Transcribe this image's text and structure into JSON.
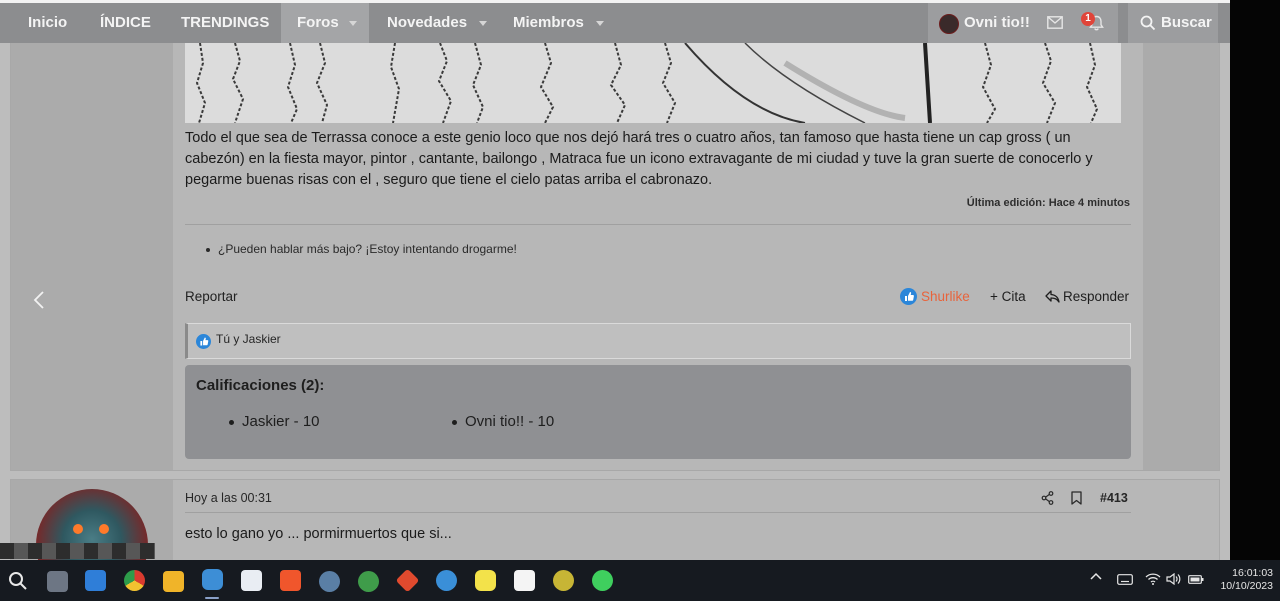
{
  "nav": {
    "items": [
      "Inicio",
      "ÍNDICE",
      "TRENDINGS",
      "Foros",
      "Novedades",
      "Miembros"
    ],
    "active": "Foros",
    "user_name": "Ovni tio!!",
    "notification_count": "1",
    "search_label": "Buscar"
  },
  "post": {
    "body": "Todo el que sea de Terrassa conoce a este genio loco que nos dejó hará tres o cuatro años, tan famoso que hasta tiene un cap gross ( un cabezón) en la fiesta mayor, pintor , cantante, bailongo , Matraca fue un icono extravagante de mi ciudad y tuve la gran suerte de conocerlo y pegarme buenas risas con el , seguro que tiene el cielo patas arriba el cabronazo.",
    "edit_note": "Última edición: Hace 4 minutos",
    "signature": "¿Pueden hablar más bajo? ¡Estoy intentando drogarme!",
    "report_label": "Reportar",
    "like_label": "Shurlike",
    "quote_label": "+ Cita",
    "reply_label": "Responder",
    "reactions_text": "Tú y Jaskier",
    "ratings_title": "Calificaciones (2):",
    "ratings": [
      "Jaskier - 10",
      "Ovni tio!! - 10"
    ]
  },
  "post2": {
    "timestamp": "Hoy a las 00:31",
    "number": "#413",
    "body": "esto lo gano yo ... pormirmuertos que si..."
  },
  "taskbar": {
    "time": "16:01:03",
    "date": "10/10/2023"
  },
  "colors": {
    "nav_bg": "#8c8d8f",
    "like_accent": "#e8643c",
    "like_blue": "#2b86d9",
    "badge_red": "#e0453a",
    "taskbar_bg": "#161a20"
  }
}
